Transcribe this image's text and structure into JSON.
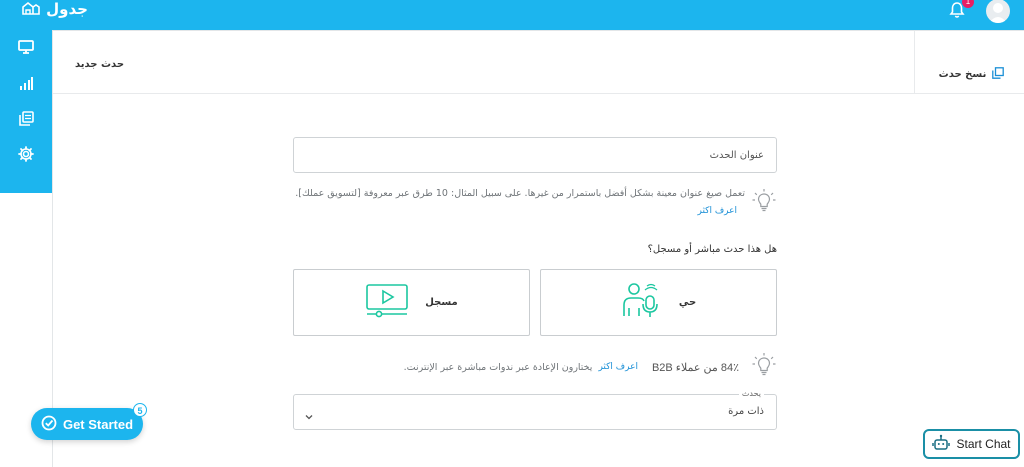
{
  "brand": {
    "name": "جدول"
  },
  "notifications": {
    "count": "1"
  },
  "header": {
    "new_event_label": "حدث جديد",
    "copy_event_label": "نسخ حدث"
  },
  "form": {
    "title_placeholder": "عنوان الحدث",
    "tip_text": "تعمل صيغ عنوان معينة بشكل أفضل باستمرار من غيرها. على سبيل المثال: 10 طرق عبر معروفة [لتسويق عملك].",
    "tip_link": "اعرف اكثر",
    "question": "هل هذا حدث مباشر أو مسجل؟",
    "options": [
      {
        "label": "حي"
      },
      {
        "label": "مسجل"
      }
    ],
    "tip2_text": "يختارون الإعادة عبر ندوات مباشرة عبر الإنترنت.",
    "tip2_link": "اعرف اكثر",
    "tip2_stat": "84٪ من عملاء B2B",
    "select_legend": "يحدث",
    "select_value": "ذات مرة"
  },
  "widgets": {
    "get_started_label": "Get Started",
    "get_started_badge": "5",
    "start_chat_label": "Start Chat"
  },
  "colors": {
    "brand_blue": "#1cb5ee",
    "option_icon": "#1bc7a0",
    "badge_pink": "#e91e63"
  }
}
